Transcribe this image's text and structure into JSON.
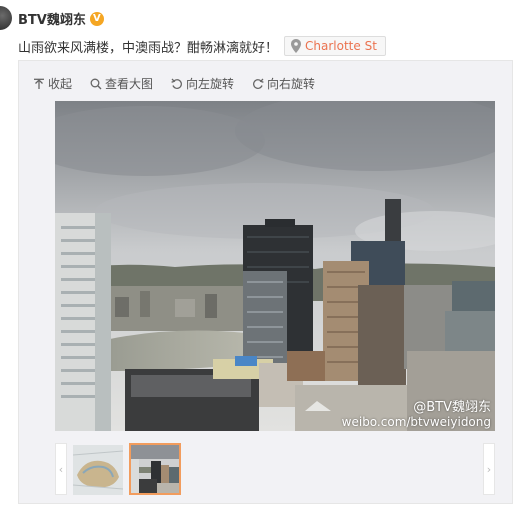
{
  "author": {
    "name": "BTV魏翊东",
    "verified_badge": "V",
    "badge_color": "#f5a623"
  },
  "post": {
    "text": "山雨欲来风满楼，中澳雨战？酣畅淋漓就好！"
  },
  "location": {
    "label": "Charlotte St",
    "icon": "location-pin-icon",
    "color": "#eb7350"
  },
  "toolbar": {
    "collapse_label": "收起",
    "view_large_label": "查看大图",
    "rotate_left_label": "向左旋转",
    "rotate_right_label": "向右旋转"
  },
  "photo": {
    "watermark_handle": "@BTV魏翊东",
    "watermark_url": "weibo.com/btvweiyidong"
  },
  "thumbnails": {
    "prev_arrow": "‹",
    "next_arrow": "›",
    "selected_index": 1,
    "selected_border_color": "#f29c5d"
  }
}
